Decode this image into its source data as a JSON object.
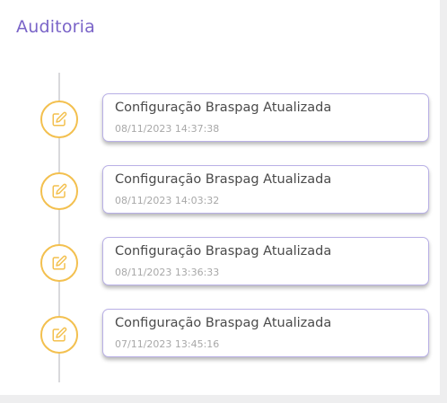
{
  "header": {
    "title": "Auditoria"
  },
  "colors": {
    "accent": "#7a64c8",
    "badge_border": "#f3c04f",
    "card_border": "#b9b0e6"
  },
  "entries": [
    {
      "title": "Configuração Braspag Atualizada",
      "datetime": "08/11/2023 14:37:38",
      "icon": "edit-icon"
    },
    {
      "title": "Configuração Braspag Atualizada",
      "datetime": "08/11/2023 14:03:32",
      "icon": "edit-icon"
    },
    {
      "title": "Configuração Braspag Atualizada",
      "datetime": "08/11/2023 13:36:33",
      "icon": "edit-icon"
    },
    {
      "title": "Configuração Braspag Atualizada",
      "datetime": "07/11/2023 13:45:16",
      "icon": "edit-icon"
    }
  ]
}
